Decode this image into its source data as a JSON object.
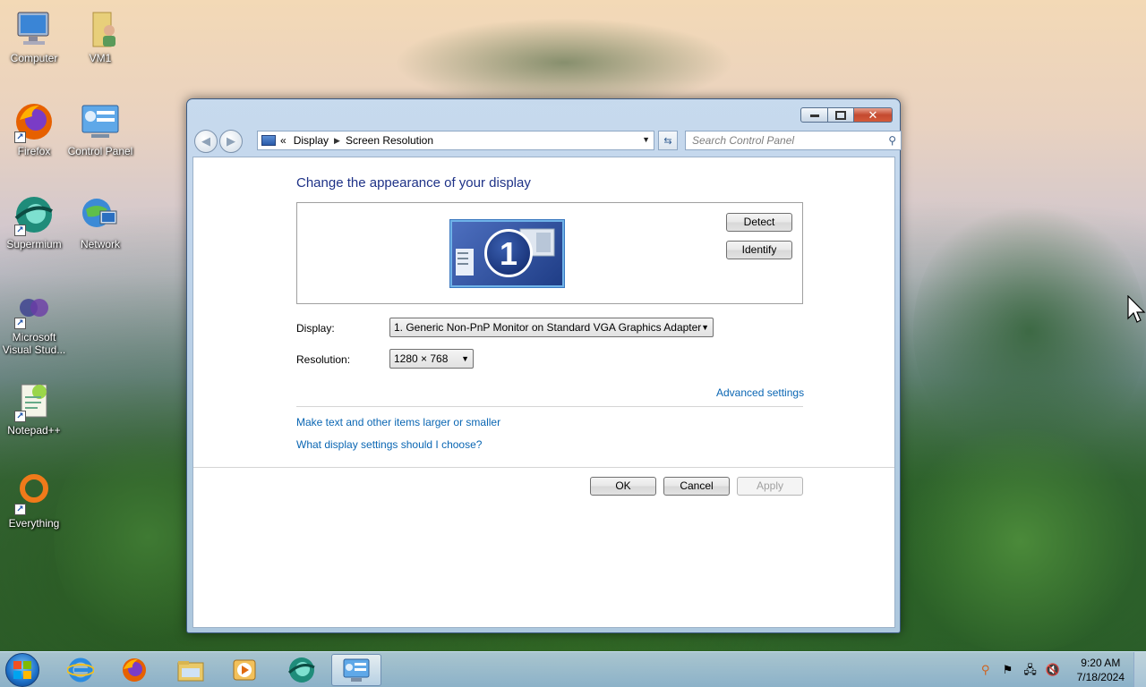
{
  "desktop": {
    "icons": [
      {
        "label": "Computer",
        "icon": "computer-icon"
      },
      {
        "label": "VM1",
        "icon": "user-folder-icon"
      },
      {
        "label": "Firefox",
        "icon": "firefox-icon"
      },
      {
        "label": "Control Panel",
        "icon": "control-panel-icon"
      },
      {
        "label": "Supermium",
        "icon": "supermium-icon"
      },
      {
        "label": "Network",
        "icon": "network-icon"
      },
      {
        "label": "Microsoft Visual Stud...",
        "icon": "visual-studio-icon"
      },
      {
        "label": "Notepad++",
        "icon": "notepad-plus-plus-icon"
      },
      {
        "label": "Everything",
        "icon": "everything-search-icon"
      }
    ]
  },
  "window": {
    "breadcrumb": {
      "prefix": "«",
      "items": [
        "Display",
        "Screen Resolution"
      ]
    },
    "search_placeholder": "Search Control Panel",
    "heading": "Change the appearance of your display",
    "monitor_number": "1",
    "detect_label": "Detect",
    "identify_label": "Identify",
    "display_label": "Display:",
    "display_value": "1. Generic Non-PnP Monitor on Standard VGA Graphics Adapter",
    "resolution_label": "Resolution:",
    "resolution_value": "1280 × 768",
    "advanced_link": "Advanced settings",
    "link_text_size": "Make text and other items larger or smaller",
    "link_help": "What display settings should I choose?",
    "ok_label": "OK",
    "cancel_label": "Cancel",
    "apply_label": "Apply"
  },
  "taskbar": {
    "pinned": [
      "internet-explorer-icon",
      "firefox-icon",
      "file-explorer-icon",
      "media-player-icon",
      "supermium-icon",
      "control-panel-icon"
    ],
    "clock_time": "9:20 AM",
    "clock_date": "7/18/2024"
  },
  "colors": {
    "heading": "#1e3287",
    "link": "#0a66b3",
    "close_button": "#c44a30"
  }
}
